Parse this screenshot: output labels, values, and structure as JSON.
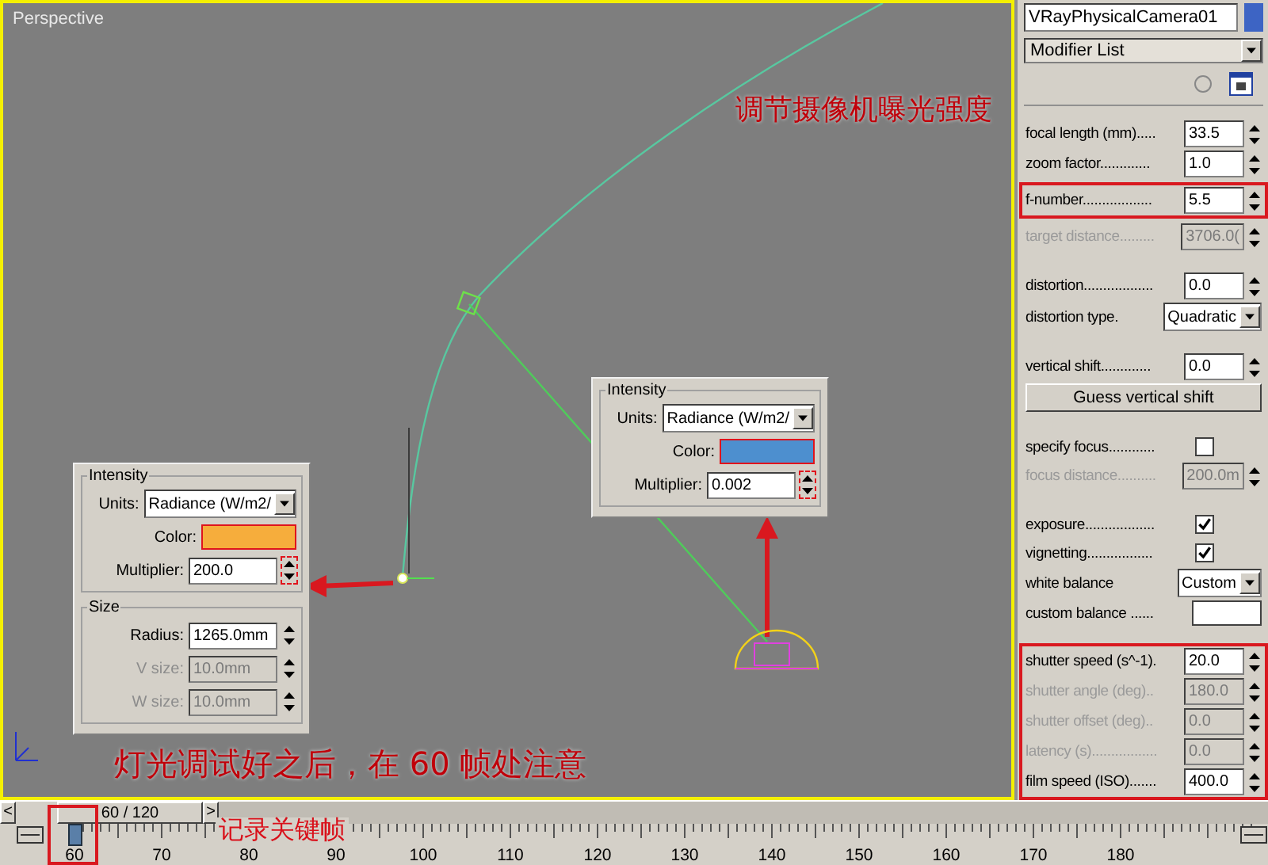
{
  "viewport": {
    "label": "Perspective",
    "active": true
  },
  "notes": {
    "camera_note": "调节摄像机曝光强度",
    "light_note": "灯光调试好之后，在 60 帧处注意",
    "key_note": "记录关键帧"
  },
  "light_dialog": {
    "groups": [
      {
        "title": "Intensity",
        "rows": [
          {
            "kind": "dropdown",
            "label": "Units:",
            "value": "Radiance (W/m2/",
            "disabled": false,
            "highlighted": false
          },
          {
            "kind": "swatch",
            "label": "Color:",
            "color": "#f6ad3c",
            "disabled": false,
            "highlighted": true
          },
          {
            "kind": "spinner",
            "label": "Multiplier:",
            "value": "200.0",
            "disabled": false,
            "highlighted": true
          }
        ]
      },
      {
        "title": "Size",
        "rows": [
          {
            "kind": "spinner",
            "label": "Radius:",
            "value": "1265.0mm",
            "disabled": false,
            "highlighted": false
          },
          {
            "kind": "spinner",
            "label": "V size:",
            "value": "10.0mm",
            "disabled": true,
            "highlighted": false
          },
          {
            "kind": "spinner",
            "label": "W size:",
            "value": "10.0mm",
            "disabled": true,
            "highlighted": false
          }
        ]
      }
    ]
  },
  "camera_dialog": {
    "groups": [
      {
        "title": "Intensity",
        "rows": [
          {
            "kind": "dropdown",
            "label": "Units:",
            "value": "Radiance (W/m2/",
            "disabled": false,
            "highlighted": false
          },
          {
            "kind": "swatch",
            "label": "Color:",
            "color": "#4d8fcf",
            "disabled": false,
            "highlighted": true
          },
          {
            "kind": "spinner",
            "label": "Multiplier:",
            "value": "0.002",
            "disabled": false,
            "highlighted": true
          }
        ]
      }
    ]
  },
  "command_panel": {
    "object": {
      "name": "VRayPhysicalCamera01",
      "color": "#3d64c4"
    },
    "modifier_list": "Modifier List",
    "sections": [
      [
        {
          "kind": "spinner",
          "label": "focal length (mm).....",
          "value": "33.5",
          "disabled": false,
          "highlighted": false
        },
        {
          "kind": "spinner",
          "label": "zoom factor.............",
          "value": "1.0",
          "disabled": false,
          "highlighted": false
        },
        {
          "kind": "spinner",
          "label": "f-number..................",
          "value": "5.5",
          "disabled": false,
          "highlighted": true
        },
        {
          "kind": "spinner",
          "label": "target distance.........",
          "value": "3706.0(",
          "disabled": true,
          "highlighted": false
        }
      ],
      [
        {
          "kind": "spinner",
          "label": "distortion..................",
          "value": "0.0",
          "disabled": false,
          "highlighted": false
        },
        {
          "kind": "dropdown",
          "label": "distortion type.",
          "value": "Quadratic",
          "disabled": false,
          "highlighted": false
        }
      ],
      [
        {
          "kind": "spinner",
          "label": "vertical shift.............",
          "value": "0.0",
          "disabled": false,
          "highlighted": false
        },
        {
          "kind": "button",
          "label": "Guess vertical shift",
          "disabled": false,
          "highlighted": false
        }
      ],
      [
        {
          "kind": "checkbox",
          "label": "specify focus............",
          "checked": false,
          "disabled": false,
          "highlighted": false
        },
        {
          "kind": "spinner",
          "label": "focus distance..........",
          "value": "200.0m",
          "disabled": true,
          "highlighted": false
        }
      ],
      [
        {
          "kind": "checkbox",
          "label": "exposure..................",
          "checked": true,
          "disabled": false,
          "highlighted": false
        },
        {
          "kind": "checkbox",
          "label": "vignetting.................",
          "checked": true,
          "disabled": false,
          "highlighted": false
        },
        {
          "kind": "dropdown",
          "label": "white balance",
          "value": "Custom",
          "disabled": false,
          "highlighted": false
        },
        {
          "kind": "swatch",
          "label": "custom balance ......",
          "color": "#ffffff",
          "disabled": false,
          "highlighted": false
        }
      ],
      [
        {
          "kind": "spinner",
          "label": "shutter speed (s^-1).",
          "value": "20.0",
          "disabled": false,
          "highlighted": true
        },
        {
          "kind": "spinner",
          "label": "shutter angle (deg)..",
          "value": "180.0",
          "disabled": true,
          "highlighted": true
        },
        {
          "kind": "spinner",
          "label": "shutter offset (deg)..",
          "value": "0.0",
          "disabled": true,
          "highlighted": true
        },
        {
          "kind": "spinner",
          "label": "latency (s).................",
          "value": "0.0",
          "disabled": true,
          "highlighted": true
        },
        {
          "kind": "spinner",
          "label": "film speed (ISO).......",
          "value": "400.0",
          "disabled": false,
          "highlighted": true
        }
      ]
    ]
  },
  "time_slider": {
    "prev": "<",
    "thumb": "60 / 120",
    "next": ">"
  },
  "ruler": {
    "highlighted": true,
    "labels": [
      {
        "label": "60",
        "current": true
      },
      {
        "label": "70",
        "current": false
      },
      {
        "label": "80",
        "current": false
      },
      {
        "label": "90",
        "current": false
      },
      {
        "label": "100",
        "current": false
      },
      {
        "label": "110",
        "current": false
      },
      {
        "label": "120",
        "current": false
      },
      {
        "label": "130",
        "current": false
      },
      {
        "label": "140",
        "current": false
      },
      {
        "label": "150",
        "current": false
      },
      {
        "label": "160",
        "current": false
      },
      {
        "label": "170",
        "current": false
      },
      {
        "label": "180",
        "current": false
      }
    ]
  }
}
